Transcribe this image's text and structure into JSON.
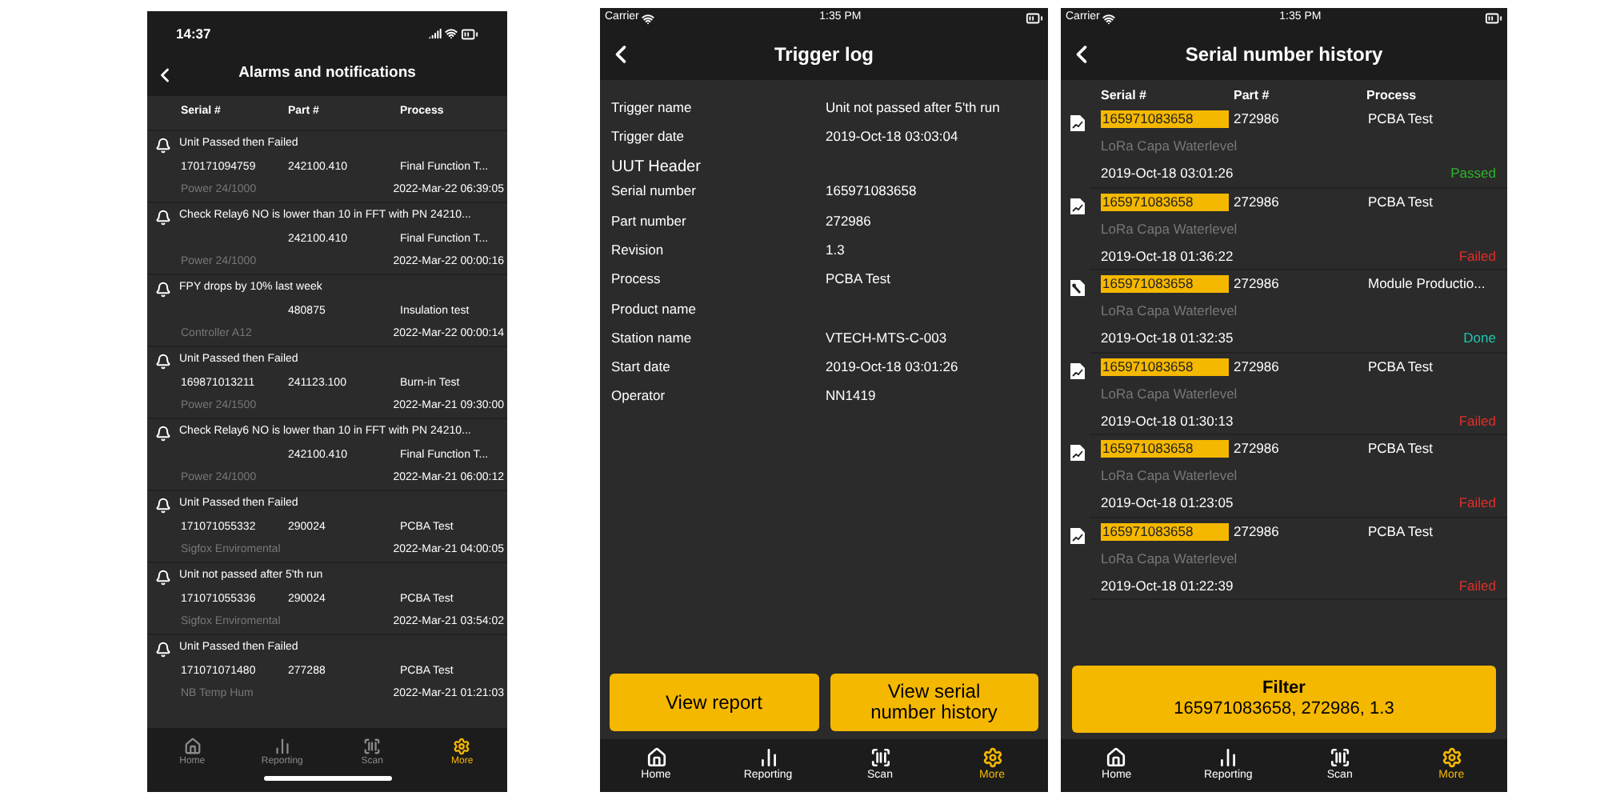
{
  "alarms_screen": {
    "status_bar": {
      "time": "14:37"
    },
    "title": "Alarms and notifications",
    "columns": [
      "Serial #",
      "Part #",
      "Process"
    ],
    "alarms": [
      {
        "title": "Unit Passed then Failed",
        "serial": "170171094759",
        "part": "242100.410",
        "process": "Final Function T...",
        "product": "Power 24/1000",
        "date": "2022-Mar-22 06:39:05"
      },
      {
        "title": "Check Relay6 NO is lower than 10 in FFT with PN 24210...",
        "part": "242100.410",
        "process": "Final Function T...",
        "product": "Power 24/1000",
        "date": "2022-Mar-22 00:00:16"
      },
      {
        "title": "FPY drops by 10% last week",
        "part": "480875",
        "process": "Insulation test",
        "product": "Controller A12",
        "date": "2022-Mar-22 00:00:14"
      },
      {
        "title": "Unit Passed then Failed",
        "serial": "169871013211",
        "part": "241123.100",
        "process": "Burn-in Test",
        "product": "Power 24/1500",
        "date": "2022-Mar-21 09:30:00"
      },
      {
        "title": "Check Relay6 NO is lower than 10 in FFT with PN 24210...",
        "part": "242100.410",
        "process": "Final Function T...",
        "product": "Power 24/1000",
        "date": "2022-Mar-21 06:00:12"
      },
      {
        "title": "Unit Passed then Failed",
        "serial": "171071055332",
        "part": "290024",
        "process": "PCBA Test",
        "product": "Sigfox Enviromental",
        "date": "2022-Mar-21 04:00:05"
      },
      {
        "title": "Unit not passed after 5'th run",
        "serial": "171071055336",
        "part": "290024",
        "process": "PCBA Test",
        "product": "Sigfox Enviromental",
        "date": "2022-Mar-21 03:54:02"
      },
      {
        "title": "Unit Passed then Failed",
        "serial": "171071071480",
        "part": "277288",
        "process": "PCBA Test",
        "product": "NB Temp Hum",
        "date": "2022-Mar-21 01:21:03"
      }
    ],
    "tabs": [
      {
        "kind": "home",
        "label": "Home",
        "selected": false
      },
      {
        "kind": "chart",
        "label": "Reporting",
        "selected": false
      },
      {
        "kind": "scan",
        "label": "Scan",
        "selected": false
      },
      {
        "kind": "gear",
        "label": "More",
        "selected": true
      }
    ]
  },
  "trigger_log_screen": {
    "status_bar": {
      "carrier": "Carrier",
      "time": "1:35 PM"
    },
    "title": "Trigger log",
    "trigger": [
      {
        "label": "Trigger name",
        "value": "Unit not passed after 5'th run"
      },
      {
        "label": "Trigger date",
        "value": "2019-Oct-18 03:03:04"
      }
    ],
    "uut_header": {
      "title": "UUT Header",
      "fields": [
        {
          "label": "Serial number",
          "value": "165971083658"
        },
        {
          "label": "Part number",
          "value": "272986"
        },
        {
          "label": "Revision",
          "value": "1.3"
        },
        {
          "label": "Process",
          "value": "PCBA Test"
        },
        {
          "label": "Product name"
        },
        {
          "label": "Station name",
          "value": "VTECH-MTS-C-003"
        },
        {
          "label": "Start date",
          "value": "2019-Oct-18 03:01:26"
        },
        {
          "label": "Operator",
          "value": "NN1419"
        }
      ]
    },
    "buttons": [
      "View report",
      "View serial number history"
    ],
    "tabs": [
      {
        "kind": "home",
        "label": "Home",
        "selected": false
      },
      {
        "kind": "chart",
        "label": "Reporting",
        "selected": false
      },
      {
        "kind": "scan",
        "label": "Scan",
        "selected": false
      },
      {
        "kind": "gear",
        "label": "More",
        "selected": true
      }
    ]
  },
  "serial_history_screen": {
    "status_bar": {
      "carrier": "Carrier",
      "time": "1:35 PM"
    },
    "title": "Serial number history",
    "columns": [
      "Serial #",
      "Part #",
      "Process"
    ],
    "items": [
      {
        "kind": "chart",
        "serial": "165971083658",
        "part": "272986",
        "process": "PCBA Test",
        "product": "LoRa Capa Waterlevel",
        "date": "2019-Oct-18 03:01:26",
        "result": "Passed",
        "color": "#2db52d"
      },
      {
        "kind": "chart",
        "serial": "165971083658",
        "part": "272986",
        "process": "PCBA Test",
        "product": "LoRa Capa Waterlevel",
        "date": "2019-Oct-18 01:36:22",
        "result": "Failed",
        "color": "#e0302a"
      },
      {
        "kind": "wrench",
        "serial": "165971083658",
        "part": "272986",
        "process": "Module Productio...",
        "product": "LoRa Capa Waterlevel",
        "date": "2019-Oct-18 01:32:35",
        "result": "Done",
        "color": "#1fc5b0"
      },
      {
        "kind": "chart",
        "serial": "165971083658",
        "part": "272986",
        "process": "PCBA Test",
        "product": "LoRa Capa Waterlevel",
        "date": "2019-Oct-18 01:30:13",
        "result": "Failed",
        "color": "#e0302a"
      },
      {
        "kind": "chart",
        "serial": "165971083658",
        "part": "272986",
        "process": "PCBA Test",
        "product": "LoRa Capa Waterlevel",
        "date": "2019-Oct-18 01:23:05",
        "result": "Failed",
        "color": "#e0302a"
      },
      {
        "kind": "chart",
        "serial": "165971083658",
        "part": "272986",
        "process": "PCBA Test",
        "product": "LoRa Capa Waterlevel",
        "date": "2019-Oct-18 01:22:39",
        "result": "Failed",
        "color": "#e0302a"
      }
    ],
    "filter": {
      "title": "Filter",
      "value": "165971083658, 272986, 1.3"
    },
    "tabs": [
      {
        "kind": "home",
        "label": "Home",
        "selected": false
      },
      {
        "kind": "chart",
        "label": "Reporting",
        "selected": false
      },
      {
        "kind": "scan",
        "label": "Scan",
        "selected": false
      },
      {
        "kind": "gear",
        "label": "More",
        "selected": true
      }
    ]
  }
}
